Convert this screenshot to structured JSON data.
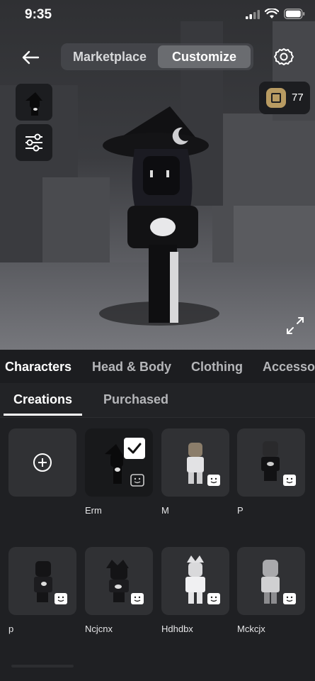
{
  "status_bar": {
    "time": "9:35"
  },
  "header": {
    "tabs": [
      {
        "label": "Marketplace",
        "active": false
      },
      {
        "label": "Customize",
        "active": true
      }
    ]
  },
  "robux": {
    "amount": "77"
  },
  "category_tabs": [
    "Characters",
    "Head & Body",
    "Clothing",
    "Accesso"
  ],
  "sub_tabs": [
    {
      "label": "Creations",
      "active": true
    },
    {
      "label": "Purchased",
      "active": false
    }
  ],
  "characters": [
    {
      "name": "Erm",
      "selected": true
    },
    {
      "name": "M",
      "selected": false
    },
    {
      "name": "P",
      "selected": false
    },
    {
      "name": "p",
      "selected": false
    },
    {
      "name": "Ncjcnx",
      "selected": false
    },
    {
      "name": "Hdhdbx",
      "selected": false
    },
    {
      "name": "Mckcjx",
      "selected": false
    }
  ],
  "colors": {
    "accent": "#b89b62",
    "background": "#1f2023",
    "tile": "#303134"
  }
}
